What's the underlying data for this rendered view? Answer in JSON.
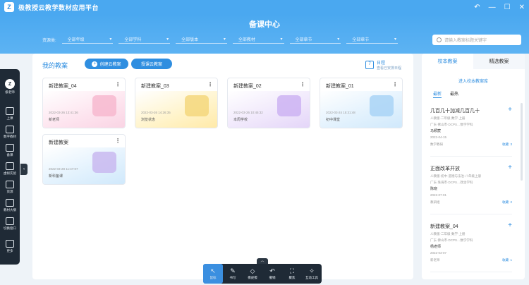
{
  "app": {
    "title": "极教授云教学数材应用平台",
    "logo": "Z"
  },
  "window": {
    "buttons": [
      "↶",
      "—",
      "☐",
      "✕"
    ]
  },
  "header": {
    "page_title": "备课中心"
  },
  "filters": {
    "label": "资源类:",
    "selects": [
      "全部年级",
      "全部学科",
      "全部版本",
      "全部教材",
      "全部章节",
      "全部章节"
    ]
  },
  "search": {
    "placeholder": "请输入教案标题关键字"
  },
  "main": {
    "title": "我的教案",
    "create_button": "创建云教案",
    "online_button": "授课云教案",
    "schedule": {
      "label": "日程",
      "sub": "查看已安排日程"
    }
  },
  "cards": [
    {
      "title": "新建教案_04",
      "date": "2022-03-26 13:41:36",
      "author": "新老师",
      "theme": "pink"
    },
    {
      "title": "新建教案_03",
      "date": "2022-03-26 14:26:35",
      "author": "浏览状态",
      "theme": "yellow"
    },
    {
      "title": "新建教案_02",
      "date": "2022-03-26 10:45:32",
      "author": "本周学校",
      "theme": "purple"
    },
    {
      "title": "新建教案_01",
      "date": "2022-03-24 15:31:48",
      "author": "初中课堂",
      "theme": "blue"
    },
    {
      "title": "新建教案",
      "date": "2022-03-28 11:47:07",
      "author": "新科备课",
      "theme": "blue"
    }
  ],
  "right": {
    "tabs": [
      "校本教案",
      "精选教案"
    ],
    "join_link": "进入校本教案库",
    "subtabs": [
      "最新",
      "最热"
    ],
    "items": [
      {
        "title": "几百几十加减几百几十",
        "meta1": "人教版·二年级·数学·上册",
        "meta2": "广东·佛山市·DCPS…数学学科",
        "subject": "马颖宸",
        "date": "2022-04-15",
        "sub2": "数学教研",
        "count": "收藏: 3"
      },
      {
        "title": "正面改革开放",
        "meta1": "人教版·初中·道德与法治·八年级上册",
        "meta2": "广东·珠海市·DCPS…政治学科",
        "subject": "陈晓",
        "date": "2022-07-01",
        "sub2": "教研组",
        "count": "收藏: 2"
      },
      {
        "title": "新建教案_04",
        "meta1": "人教版·二年级·数学·上册",
        "meta2": "广东·佛山市·DCPS…数学学科",
        "subject": "杨老师",
        "date": "2022-03-07",
        "sub2": "新老师",
        "count": "收藏: 1"
      }
    ]
  },
  "dock": {
    "avatar": "Z",
    "avatar_label": "极老师",
    "items": [
      "上课",
      "数字教材",
      "备课",
      "虚拟实验",
      "资源",
      "教材大纲",
      "切换窗口",
      "更多"
    ]
  },
  "toolbar": {
    "tools": [
      {
        "icon": "↖",
        "label": "鼠标"
      },
      {
        "icon": "✎",
        "label": "书写"
      },
      {
        "icon": "◇",
        "label": "橡皮擦"
      },
      {
        "icon": "↶",
        "label": "撤销"
      },
      {
        "icon": "⛶",
        "label": "聚焦"
      },
      {
        "icon": "✧",
        "label": "互动工具"
      }
    ],
    "expand": "︿"
  },
  "colors": {
    "primary": "#2f8ee0",
    "header": "#4aa8f0",
    "dock": "#1f2a36"
  }
}
